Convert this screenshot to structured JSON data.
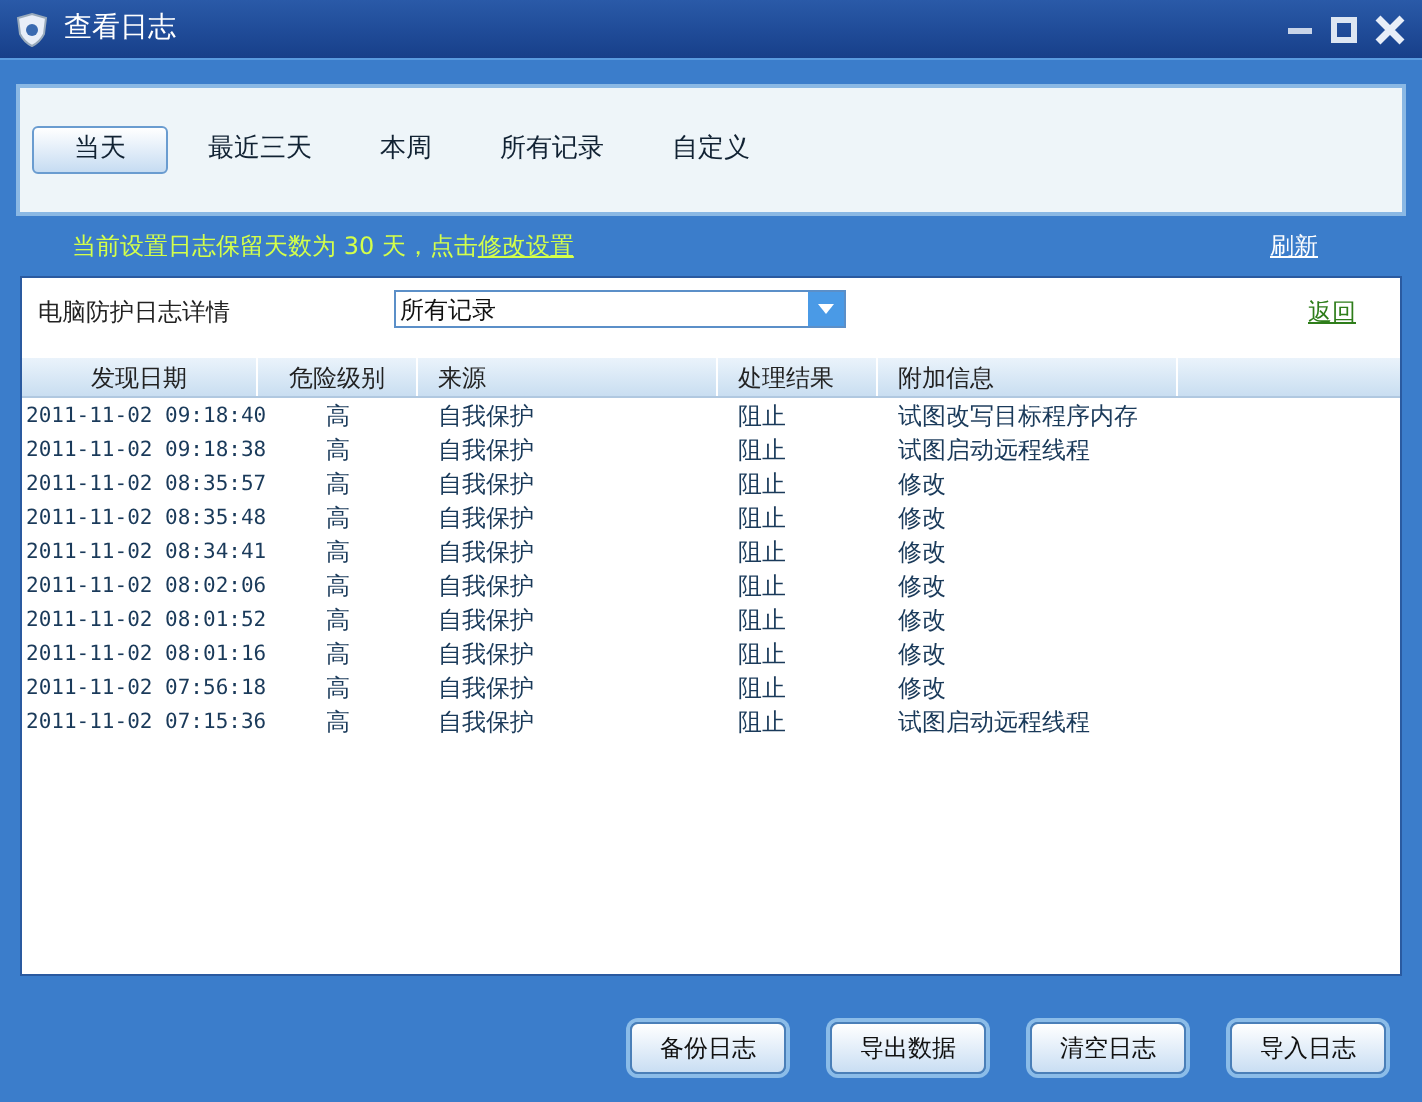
{
  "window": {
    "title": "查看日志"
  },
  "tabs": [
    {
      "label": "当天",
      "selected": true
    },
    {
      "label": "最近三天",
      "selected": false
    },
    {
      "label": "本周",
      "selected": false
    },
    {
      "label": "所有记录",
      "selected": false
    },
    {
      "label": "自定义",
      "selected": false
    }
  ],
  "notice": {
    "text": "当前设置日志保留天数为 30 天，点击",
    "link": "修改设置"
  },
  "refresh_link": "刷新",
  "detail": {
    "label": "电脑防护日志详情",
    "filter_value": "所有记录",
    "back_link": "返回"
  },
  "table": {
    "columns": [
      "发现日期",
      "危险级别",
      "来源",
      "处理结果",
      "附加信息"
    ],
    "rows": [
      [
        "2011-11-02 09:18:40",
        "高",
        "自我保护",
        "阻止",
        "试图改写目标程序内存"
      ],
      [
        "2011-11-02 09:18:38",
        "高",
        "自我保护",
        "阻止",
        "试图启动远程线程"
      ],
      [
        "2011-11-02 08:35:57",
        "高",
        "自我保护",
        "阻止",
        "修改"
      ],
      [
        "2011-11-02 08:35:48",
        "高",
        "自我保护",
        "阻止",
        "修改"
      ],
      [
        "2011-11-02 08:34:41",
        "高",
        "自我保护",
        "阻止",
        "修改"
      ],
      [
        "2011-11-02 08:02:06",
        "高",
        "自我保护",
        "阻止",
        "修改"
      ],
      [
        "2011-11-02 08:01:52",
        "高",
        "自我保护",
        "阻止",
        "修改"
      ],
      [
        "2011-11-02 08:01:16",
        "高",
        "自我保护",
        "阻止",
        "修改"
      ],
      [
        "2011-11-02 07:56:18",
        "高",
        "自我保护",
        "阻止",
        "修改"
      ],
      [
        "2011-11-02 07:15:36",
        "高",
        "自我保护",
        "阻止",
        "试图启动远程线程"
      ]
    ]
  },
  "buttons": [
    "备份日志",
    "导出数据",
    "清空日志",
    "导入日志"
  ]
}
